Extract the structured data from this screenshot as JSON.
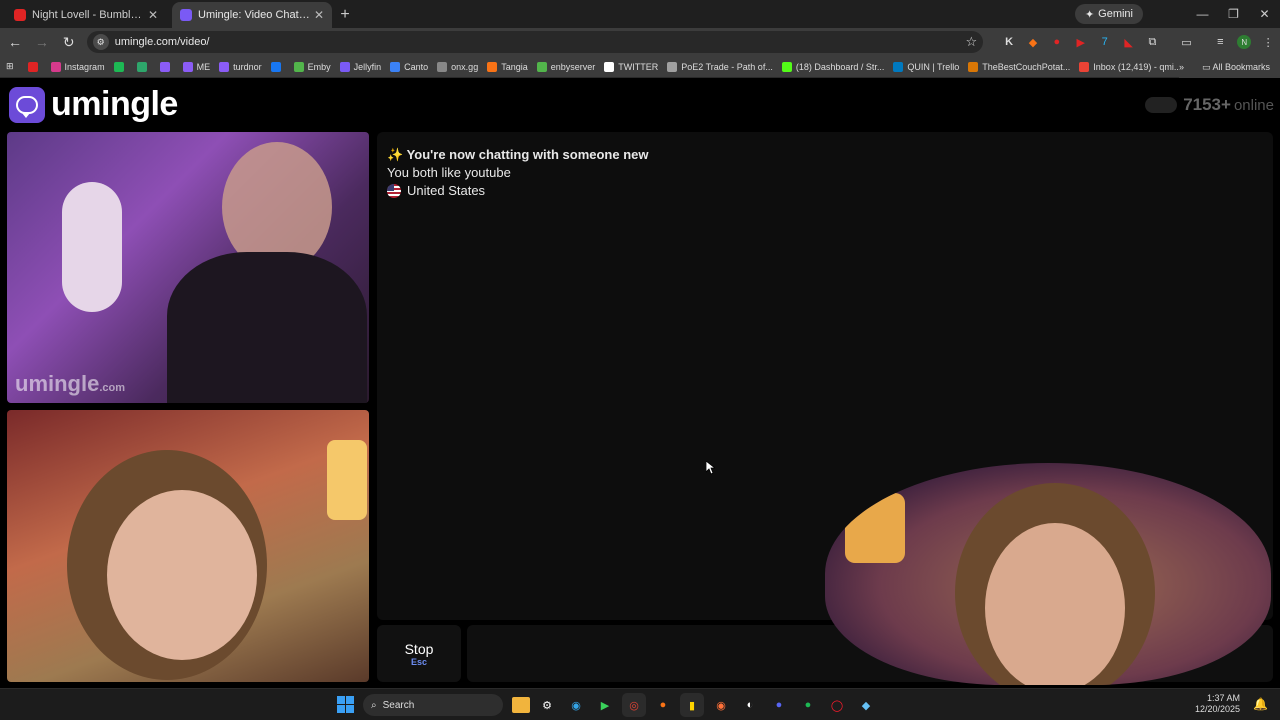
{
  "browser": {
    "tabs": [
      {
        "title": "Night Lovell - Bumblebee (KEIF",
        "favicon_color": "#e02424"
      },
      {
        "title": "Umingle: Video Chat with S",
        "favicon_color": "#7a5af5",
        "active": true
      }
    ],
    "new_tab_label": "+",
    "gemini_label": "Gemini",
    "address": "umingle.com/video/",
    "bookmarks": [
      {
        "label": "",
        "color": "#e02424"
      },
      {
        "label": "Instagram",
        "color": "#d63a8c"
      },
      {
        "label": "",
        "color": "#1db954"
      },
      {
        "label": "",
        "color": "#2ea66b"
      },
      {
        "label": "",
        "color": "#8b5cf6"
      },
      {
        "label": "ME",
        "color": "#8b5cf6"
      },
      {
        "label": "turdnor",
        "color": "#8b5cf6"
      },
      {
        "label": "",
        "color": "#1877f2"
      },
      {
        "label": "Emby",
        "color": "#52b54b"
      },
      {
        "label": "Jellyfin",
        "color": "#7a5af5"
      },
      {
        "label": "Canto",
        "color": "#3b82f6"
      },
      {
        "label": "onx.gg",
        "color": "#888888"
      },
      {
        "label": "Tangia",
        "color": "#f97316"
      },
      {
        "label": "enbyserver",
        "color": "#52b54b"
      },
      {
        "label": "TWITTER",
        "color": "#ffffff"
      },
      {
        "label": "PoE2 Trade - Path of...",
        "color": "#a0a0a0"
      },
      {
        "label": "(18) Dashboard / Str...",
        "color": "#53fc18"
      },
      {
        "label": "QUIN | Trello",
        "color": "#0079bf"
      },
      {
        "label": "TheBestCouchPotat...",
        "color": "#d97706"
      },
      {
        "label": "Inbox (12,419) - qmi...",
        "color": "#ea4335"
      }
    ],
    "all_bookmarks_label": "All Bookmarks"
  },
  "page": {
    "logo_text": "umingle",
    "online_count": "7153",
    "online_plus": "+",
    "online_label": "online",
    "watermark": "umingle",
    "watermark_suffix": ".com",
    "chat": {
      "messages": [
        {
          "icon": "✨",
          "text": "You're now chatting with someone new"
        },
        {
          "text": "You both like youtube"
        },
        {
          "flag": "us",
          "text": "United States"
        }
      ]
    },
    "stop_label": "Stop",
    "stop_shortcut": "Esc"
  },
  "taskbar": {
    "search_label": "Search",
    "time": "1:37 AM",
    "date": "12/20/2025"
  },
  "colors": {
    "brand": "#6c4bd8",
    "shortcut": "#6c8cf0"
  }
}
